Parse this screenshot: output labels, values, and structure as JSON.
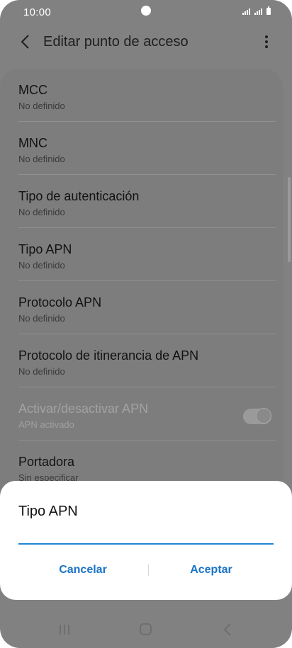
{
  "status_bar": {
    "time": "10:00"
  },
  "app_bar": {
    "title": "Editar punto de acceso"
  },
  "list": {
    "items": [
      {
        "title": "MCC",
        "subtitle": "No definido"
      },
      {
        "title": "MNC",
        "subtitle": "No definido"
      },
      {
        "title": "Tipo de autenticación",
        "subtitle": "No definido"
      },
      {
        "title": "Tipo APN",
        "subtitle": "No definido"
      },
      {
        "title": "Protocolo APN",
        "subtitle": "No definido"
      },
      {
        "title": "Protocolo de itinerancia de APN",
        "subtitle": "No definido"
      },
      {
        "title": "Activar/desactivar APN",
        "subtitle": "APN activado",
        "disabled": true,
        "toggle_on": true
      },
      {
        "title": "Portadora",
        "subtitle": "Sin especificar"
      }
    ]
  },
  "dialog": {
    "title": "Tipo APN",
    "input_value": "",
    "cancel_label": "Cancelar",
    "accept_label": "Aceptar"
  },
  "colors": {
    "accent": "#1a73c9",
    "input_underline": "#1e88d6",
    "scrim_background": "#818181"
  },
  "icons": {
    "back": "chevron-left-icon",
    "more": "more-vertical-icon",
    "nav_recents": "recents-icon",
    "nav_home": "home-icon",
    "nav_back": "nav-back-icon"
  }
}
